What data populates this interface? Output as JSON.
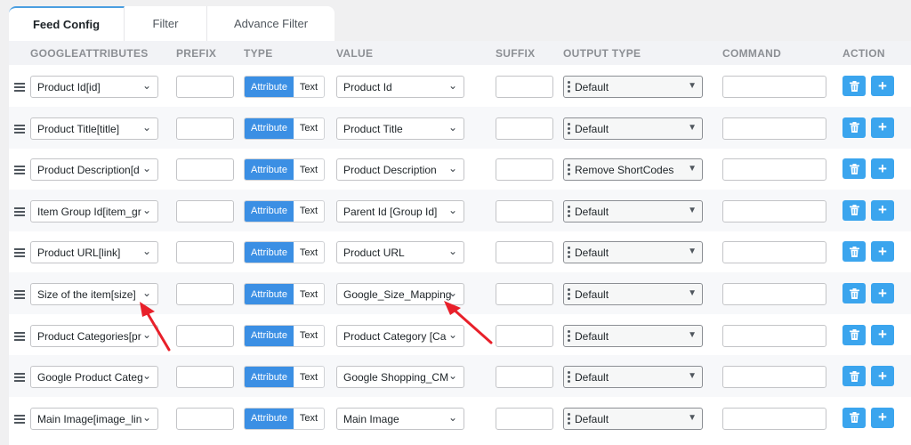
{
  "tabs": [
    "Feed Config",
    "Filter",
    "Advance Filter"
  ],
  "columns": [
    "GOOGLEATTRIBUTES",
    "PREFIX",
    "TYPE",
    "VALUE",
    "SUFFIX",
    "OUTPUT TYPE",
    "COMMAND",
    "ACTION"
  ],
  "type_toggle": {
    "active": "Attribute",
    "inactive": "Text"
  },
  "rows": [
    {
      "attribute": "Product Id[id]",
      "value": "Product Id",
      "output_type": "Default"
    },
    {
      "attribute": "Product Title[title]",
      "value": "Product Title",
      "output_type": "Default"
    },
    {
      "attribute": "Product Description[d",
      "value": "Product Description",
      "output_type": "Remove ShortCodes"
    },
    {
      "attribute": "Item Group Id[item_gr",
      "value": "Parent Id [Group Id]",
      "output_type": "Default"
    },
    {
      "attribute": "Product URL[link]",
      "value": "Product URL",
      "output_type": "Default"
    },
    {
      "attribute": "Size of the item[size]",
      "value": "Google_Size_Mapping",
      "output_type": "Default"
    },
    {
      "attribute": "Product Categories[pr",
      "value": "Product Category [Ca",
      "output_type": "Default"
    },
    {
      "attribute": "Google Product Categ",
      "value": "Google Shopping_CM",
      "output_type": "Default"
    },
    {
      "attribute": "Main Image[image_lin",
      "value": "Main Image",
      "output_type": "Default"
    }
  ],
  "icons": {
    "drag": "drag-handle-icon",
    "select": "chevron-down-icon",
    "delete": "trash-icon",
    "add": "plus-icon"
  },
  "colors": {
    "primary": "#3b8fe4",
    "action": "#3ba5ee",
    "annotation": "#e8202a"
  }
}
